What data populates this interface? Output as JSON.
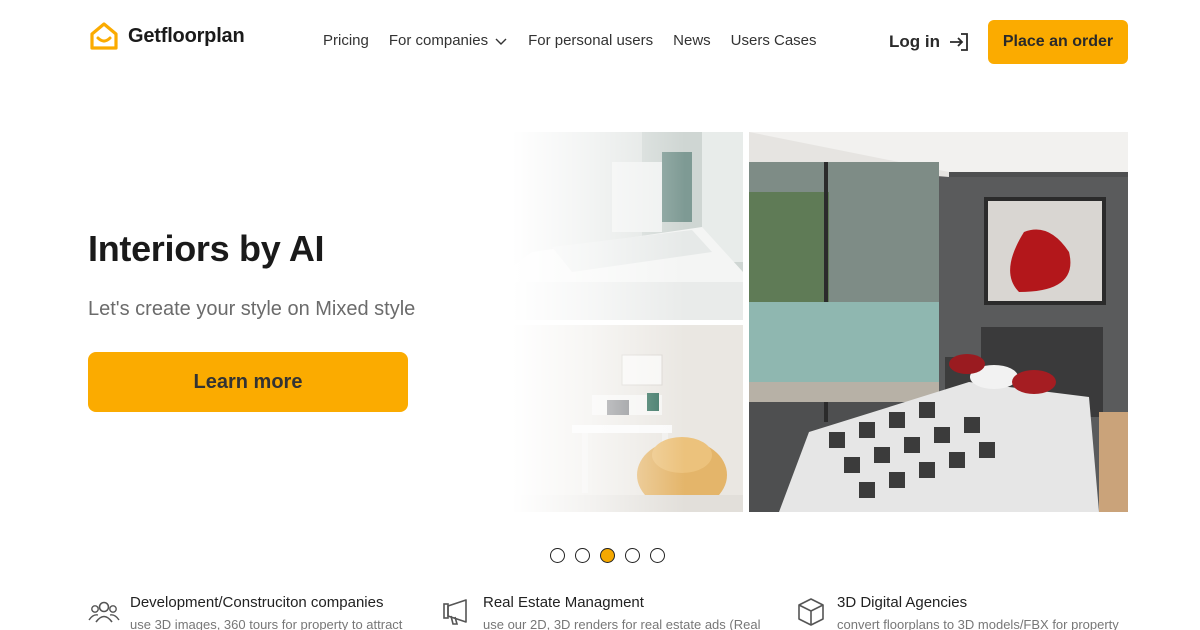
{
  "header": {
    "brand": "Getfloorplan",
    "nav": [
      {
        "label": "Pricing",
        "has_dropdown": false
      },
      {
        "label": "For companies",
        "has_dropdown": true
      },
      {
        "label": "For personal users",
        "has_dropdown": false
      },
      {
        "label": "News",
        "has_dropdown": false
      },
      {
        "label": "Users Cases",
        "has_dropdown": false
      }
    ],
    "login_label": "Log in",
    "order_label": "Place an order"
  },
  "hero": {
    "title": "Interiors by AI",
    "subtitle": "Let's create your style on Mixed style",
    "cta_label": "Learn more"
  },
  "carousel": {
    "count": 5,
    "active_index": 2
  },
  "features": [
    {
      "icon": "people-icon",
      "title": "Development/Construciton companies",
      "desc": "use 3D images, 360 tours for property to attract"
    },
    {
      "icon": "megaphone-icon",
      "title": "Real Estate Managment",
      "desc": "use our 2D, 3D renders for real estate ads (Real"
    },
    {
      "icon": "cube-icon",
      "title": "3D Digital Agencies",
      "desc": "convert floorplans to 3D models/FBX for property"
    }
  ],
  "colors": {
    "accent": "#fbab00",
    "text": "#1a1a1a",
    "muted": "#6b6b6b"
  }
}
